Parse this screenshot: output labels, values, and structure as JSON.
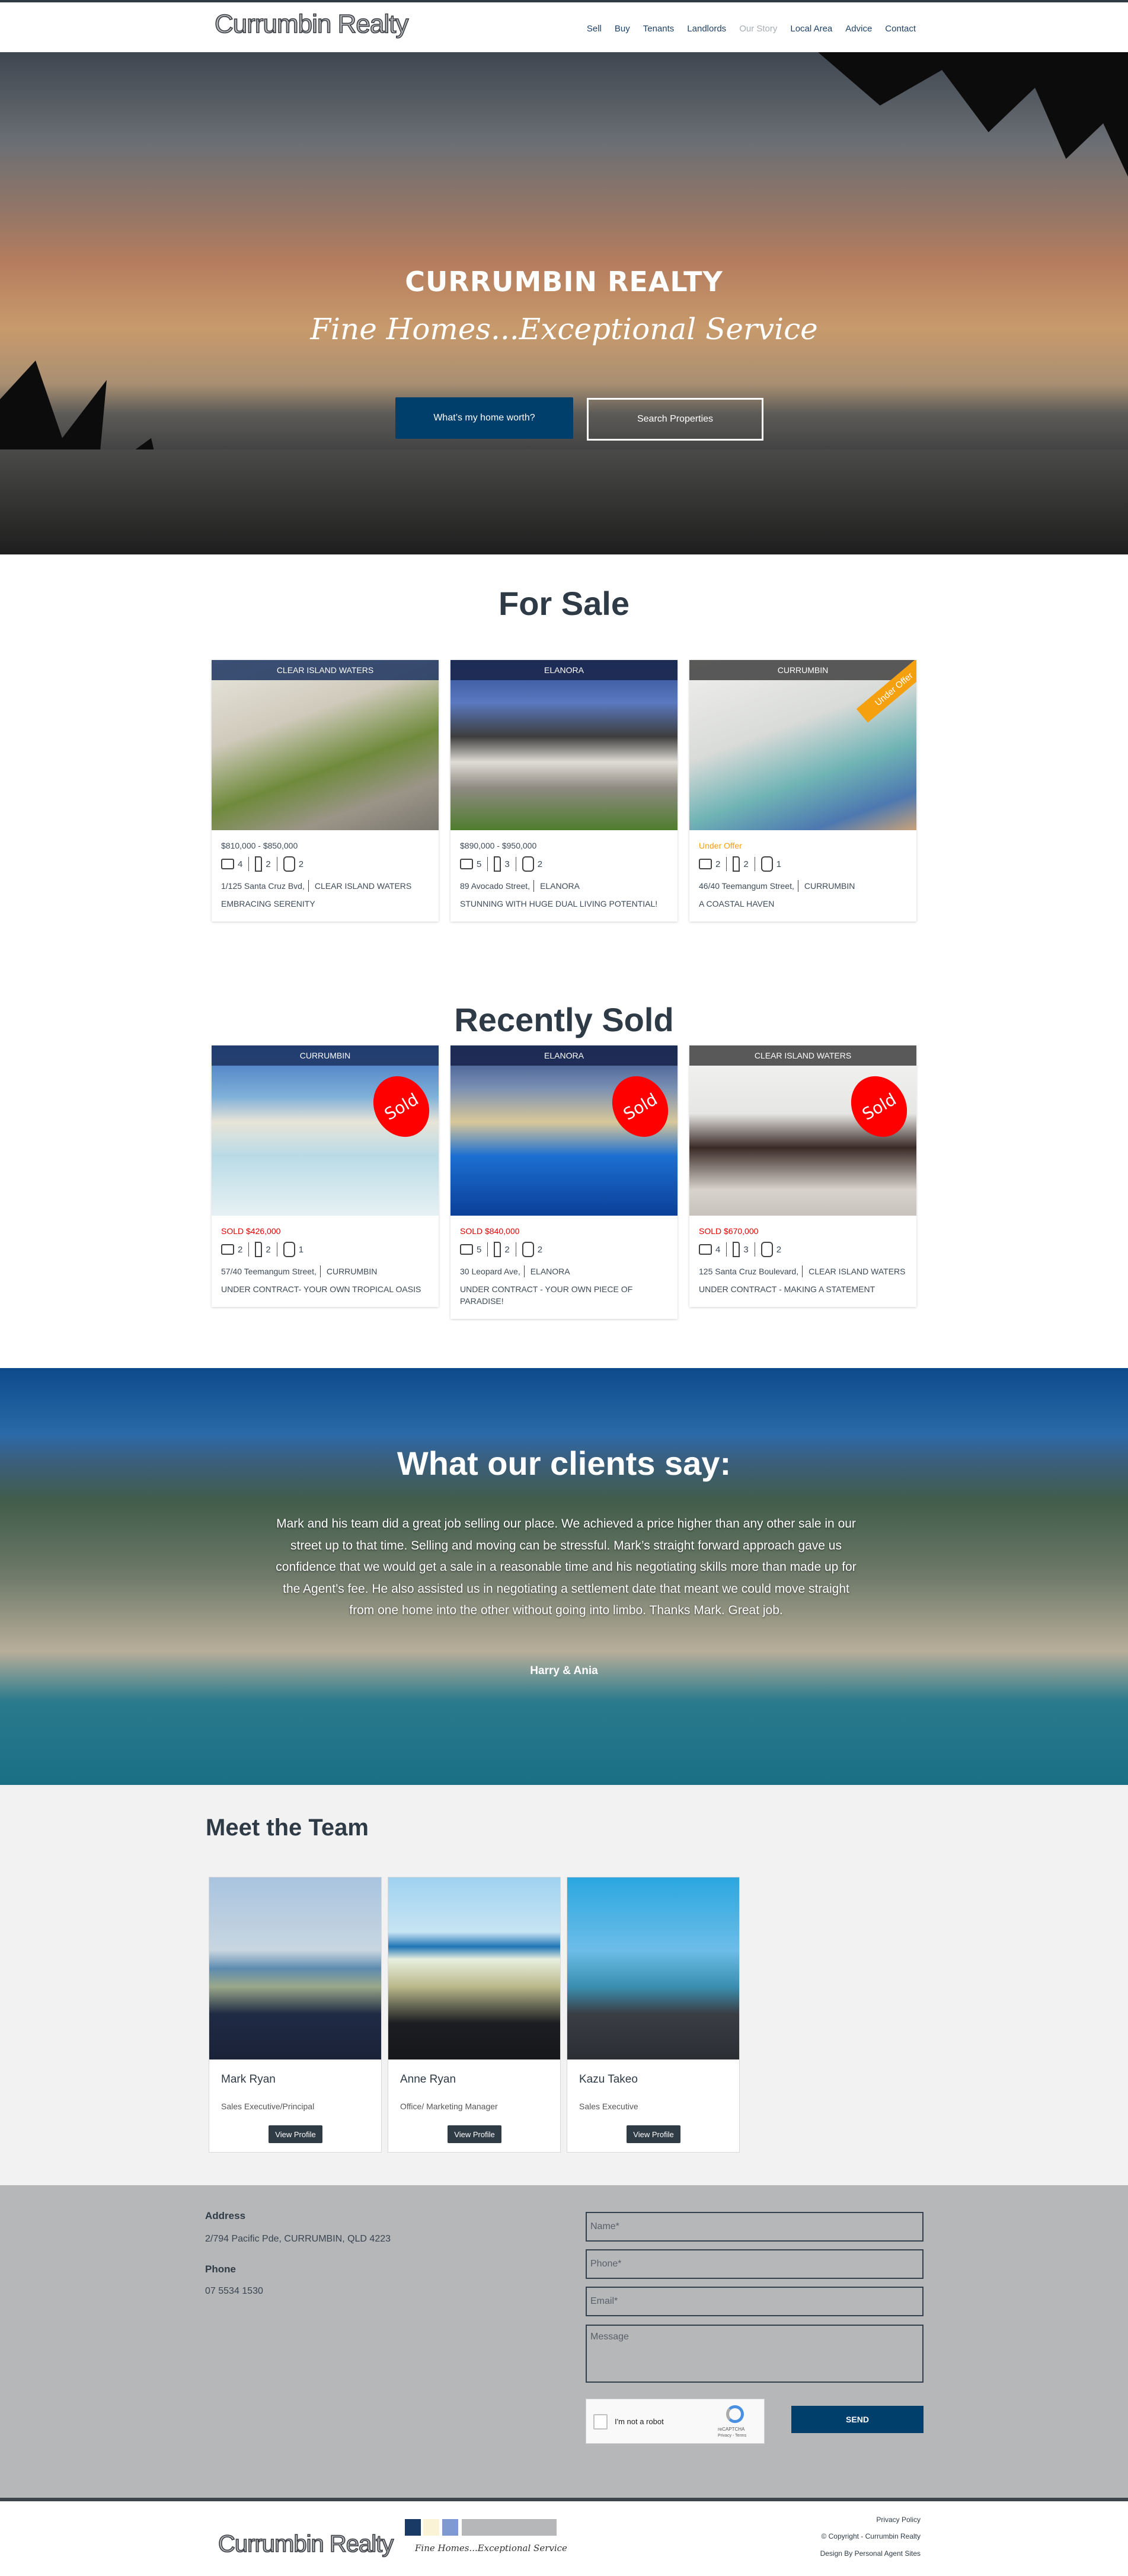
{
  "brand": {
    "logo_text": "Currumbin Realty",
    "tagline": "Fine Homes...Exceptional Service"
  },
  "nav": [
    {
      "label": "Sell"
    },
    {
      "label": "Buy"
    },
    {
      "label": "Tenants"
    },
    {
      "label": "Landlords"
    },
    {
      "label": "Our Story",
      "active": true
    },
    {
      "label": "Local Area"
    },
    {
      "label": "Advice"
    },
    {
      "label": "Contact"
    }
  ],
  "hero": {
    "title": "CURRUMBIN REALTY",
    "tagline": "Fine Homes...Exceptional Service",
    "btn_worth": "What’s my home worth?",
    "btn_search": "Search Properties"
  },
  "for_sale": {
    "title": "For Sale",
    "listings": [
      {
        "suburb": "CLEAR ISLAND WATERS",
        "price": "$810,000 - $850,000",
        "beds": "4",
        "baths": "2",
        "cars": "2",
        "street": "1/125 Santa Cruz Bvd,",
        "locality": "CLEAR ISLAND WATERS",
        "headline": "EMBRACING SERENITY"
      },
      {
        "suburb": "ELANORA",
        "price": "$890,000 - $950,000",
        "beds": "5",
        "baths": "3",
        "cars": "2",
        "street": "89 Avocado Street,",
        "locality": "ELANORA",
        "headline": "STUNNING WITH HUGE DUAL LIVING POTENTIAL!"
      },
      {
        "suburb": "CURRUMBIN",
        "price": "Under Offer",
        "ribbon": "Under Offer",
        "beds": "2",
        "baths": "2",
        "cars": "1",
        "street": "46/40 Teemangum Street,",
        "locality": "CURRUMBIN",
        "headline": "A COASTAL HAVEN"
      }
    ]
  },
  "sold": {
    "title": "Recently Sold",
    "badge": "Sold",
    "listings": [
      {
        "suburb": "CURRUMBIN",
        "price": "SOLD $426,000",
        "beds": "2",
        "baths": "2",
        "cars": "1",
        "street": "57/40 Teemangum Street,",
        "locality": "CURRUMBIN",
        "headline": "UNDER CONTRACT- YOUR OWN TROPICAL OASIS"
      },
      {
        "suburb": "ELANORA",
        "price": "SOLD $840,000",
        "beds": "5",
        "baths": "2",
        "cars": "2",
        "street": "30 Leopard Ave,",
        "locality": "ELANORA",
        "headline": "UNDER CONTRACT - YOUR OWN PIECE OF PARADISE!"
      },
      {
        "suburb": "CLEAR ISLAND WATERS",
        "price": "SOLD $670,000",
        "beds": "4",
        "baths": "3",
        "cars": "2",
        "street": "125 Santa Cruz Boulevard,",
        "locality": "CLEAR ISLAND WATERS",
        "headline": "UNDER CONTRACT - MAKING A STATEMENT"
      }
    ]
  },
  "testimonial": {
    "title": "What our clients say:",
    "quote": "Mark and his team did a great job selling our place. We achieved a price higher than any other sale in our street up to that time. Selling and moving can be stressful. Mark’s straight forward approach gave us confidence that we would get a sale in a reasonable time and his negotiating skills more than made up for the Agent’s fee. He also assisted us in negotiating a settlement date that meant we could move straight from one home into the other without going into limbo. Thanks Mark. Great job.",
    "author": "Harry & Ania"
  },
  "team": {
    "title": "Meet the Team",
    "button": "View Profile",
    "members": [
      {
        "name": "Mark Ryan",
        "role": "Sales Executive/Principal"
      },
      {
        "name": "Anne Ryan",
        "role": "Office/ Marketing Manager"
      },
      {
        "name": "Kazu Takeo",
        "role": "Sales Executive"
      }
    ]
  },
  "contact": {
    "address_label": "Address",
    "address": "2/794 Pacific Pde, CURRUMBIN, QLD 4223",
    "phone_label": "Phone",
    "phone": "07 5534 1530",
    "form": {
      "name": "Name*",
      "phone": "Phone*",
      "email": "Email*",
      "message": "Message",
      "captcha": "I'm not a robot",
      "captcha_brand": "reCAPTCHA",
      "captcha_links": "Privacy - Terms",
      "send": "SEND"
    }
  },
  "footer": {
    "privacy": "Privacy Policy",
    "copyright": "© Copyright - Currumbin Realty",
    "design": "Design By Personal Agent Sites"
  },
  "colors": {
    "primary": "#003e6b",
    "dark": "#2f3b45",
    "offer": "#f5a00f",
    "sold": "#ff0000",
    "contact_bg": "#b6b7b9"
  }
}
